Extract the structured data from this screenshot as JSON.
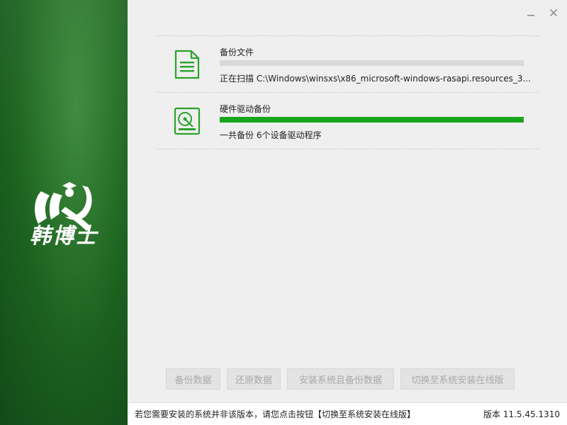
{
  "brand": {
    "name": "韩博士"
  },
  "window": {
    "minimize_icon": "minimize-icon",
    "close_icon": "close-icon"
  },
  "tasks": [
    {
      "icon": "document-icon",
      "title": "备份文件",
      "status": "正在扫描 C:\\Windows\\winsxs\\x86_microsoft-windows-rasapi.resources_3...",
      "progress": 0.0
    },
    {
      "icon": "hard-drive-icon",
      "title": "硬件驱动备份",
      "status": "一共备份 6个设备驱动程序",
      "progress": 1.0
    }
  ],
  "buttons": {
    "backup_data": "备份数据",
    "restore_data": "还原数据",
    "install_and_backup": "安装系统且备份数据",
    "switch_online": "切换至系统安装在线版"
  },
  "footer": {
    "hint": "若您需要安装的系统并非该版本，请您点击按钮【切换至系统安装在线版】",
    "version": "版本 11.5.45.1310"
  },
  "colors": {
    "accent": "#1aa51f",
    "sidebar": "#1d6420",
    "icon": "#2aa32a"
  }
}
